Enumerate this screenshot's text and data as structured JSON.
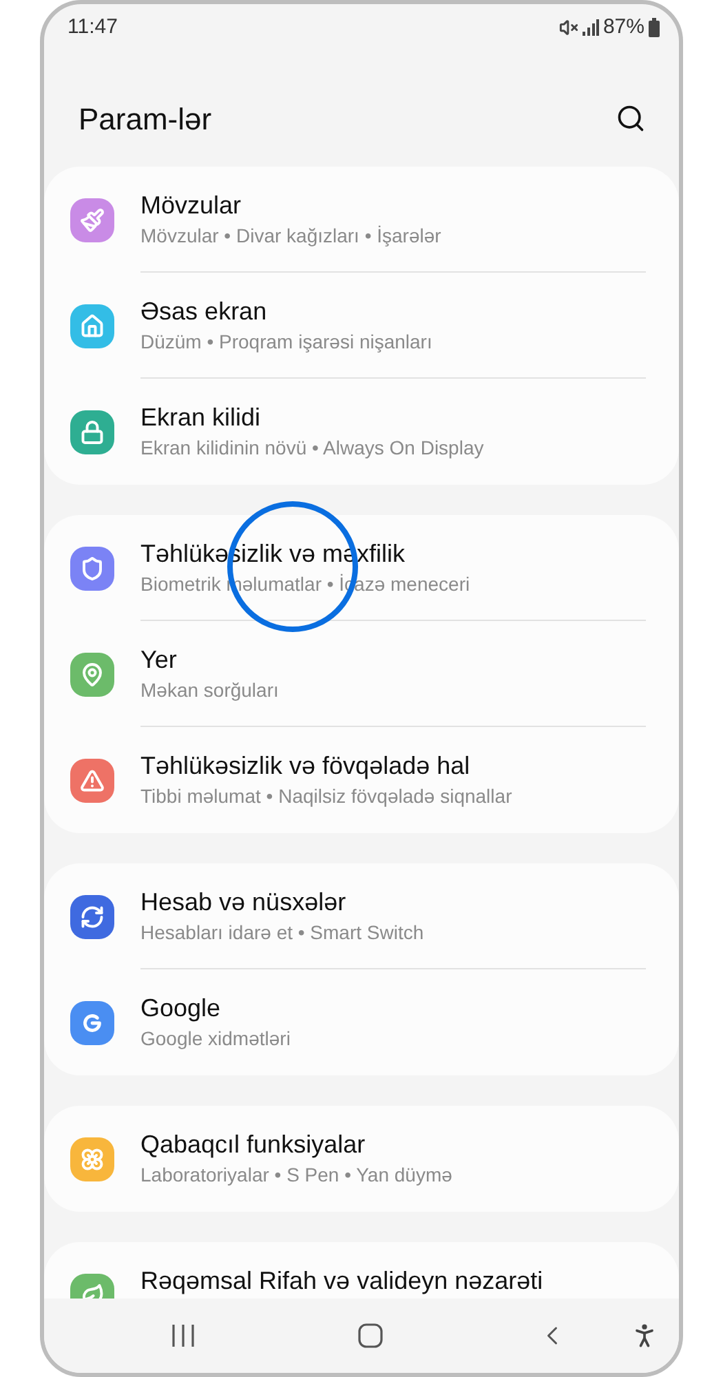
{
  "status_bar": {
    "time": "11:47",
    "battery": "87%"
  },
  "header": {
    "title": "Param-lər"
  },
  "groups": [
    {
      "items": [
        {
          "title": "Mövzular",
          "subtitle": "Mövzular • Divar kağızları • İşarələr",
          "color": "#c98be6",
          "highlighted": false
        },
        {
          "title": "Əsas ekran",
          "subtitle": "Düzüm • Proqram işarəsi nişanları",
          "color": "#33bde6",
          "highlighted": false
        },
        {
          "title": "Ekran kilidi",
          "subtitle": "Ekran kilidinin növü • Always On Display",
          "color": "#2eae92",
          "highlighted": false
        }
      ]
    },
    {
      "items": [
        {
          "title": "Təhlükəsizlik və məxfilik",
          "subtitle": "Biometrik məlumatlar • İcazə meneceri",
          "color": "#7b83f5",
          "highlighted": true
        },
        {
          "title": "Yer",
          "subtitle": "Məkan sorğuları",
          "color": "#6cbb6a",
          "highlighted": false
        },
        {
          "title": "Təhlükəsizlik və fövqəladə hal",
          "subtitle": "Tibbi məlumat • Naqilsiz fövqəladə siqnallar",
          "color": "#ee7266",
          "highlighted": false
        }
      ]
    },
    {
      "items": [
        {
          "title": "Hesab və nüsxələr",
          "subtitle": "Hesabları idarə et • Smart Switch",
          "color": "#3f6ae0",
          "highlighted": false
        },
        {
          "title": "Google",
          "subtitle": "Google xidmətləri",
          "color": "#4a8ef2",
          "highlighted": false
        }
      ]
    },
    {
      "items": [
        {
          "title": "Qabaqcıl funksiyalar",
          "subtitle": "Laboratoriyalar • S Pen • Yan düymə",
          "color": "#f8b63c",
          "highlighted": false
        }
      ]
    },
    {
      "items": [
        {
          "title": "Rəqəmsal Rifah və valideyn nəzarəti",
          "color": "#6cbb6a",
          "highlighted": false
        }
      ]
    }
  ]
}
